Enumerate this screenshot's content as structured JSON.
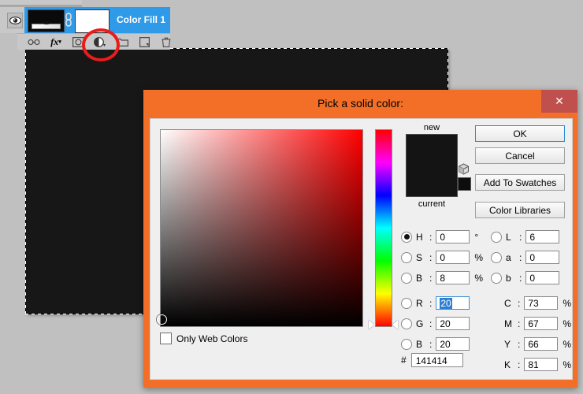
{
  "app": {
    "background_color": "#c0c0c0",
    "canvas_color": "#171717"
  },
  "layers_panel": {
    "layer": {
      "name": "Color Fill 1",
      "selected_color": "#2f9ae8",
      "visibility_icon": "eye-icon",
      "link_icon": "link-icon",
      "thumbnail_color": "#0a0a0a",
      "mask_color": "#ffffff"
    },
    "toolbar_icons": [
      {
        "name": "link-layers-icon",
        "glyph": "link"
      },
      {
        "name": "layer-style-fx-icon",
        "glyph": "fx"
      },
      {
        "name": "add-layer-mask-icon",
        "glyph": "mask"
      },
      {
        "name": "new-adjustment-layer-icon",
        "glyph": "adjustment"
      },
      {
        "name": "new-group-icon",
        "glyph": "folder"
      },
      {
        "name": "new-layer-icon",
        "glyph": "newlayer"
      },
      {
        "name": "delete-layer-icon",
        "glyph": "trash"
      }
    ],
    "highlight_ring_color": "#e81c1c"
  },
  "dialog": {
    "title": "Pick a solid color:",
    "titlebar_color": "#f36f28",
    "close_label": "✕",
    "close_color": "#c0504d",
    "buttons": {
      "ok": "OK",
      "cancel": "Cancel",
      "add_to_swatches": "Add To Swatches",
      "color_libraries": "Color Libraries"
    },
    "preview": {
      "new_label": "new",
      "current_label": "current",
      "new_color": "#141414",
      "current_color": "#141414",
      "gamut_icon": "gamut-cube-icon",
      "gamut_swatch_color": "#0d0d0d"
    },
    "web_colors": {
      "label": "Only Web Colors",
      "checked": false
    },
    "hsb": [
      {
        "key": "H",
        "value": "0",
        "unit": "°",
        "selected": true
      },
      {
        "key": "S",
        "value": "0",
        "unit": "%",
        "selected": false
      },
      {
        "key": "B",
        "value": "8",
        "unit": "%",
        "selected": false
      }
    ],
    "rgb": [
      {
        "key": "R",
        "value": "20",
        "unit": "",
        "selected": false,
        "focused": true
      },
      {
        "key": "G",
        "value": "20",
        "unit": "",
        "selected": false,
        "focused": false
      },
      {
        "key": "B",
        "value": "20",
        "unit": "",
        "selected": false,
        "focused": false
      }
    ],
    "lab": [
      {
        "key": "L",
        "value": "6",
        "unit": ""
      },
      {
        "key": "a",
        "value": "0",
        "unit": ""
      },
      {
        "key": "b",
        "value": "0",
        "unit": ""
      }
    ],
    "cmyk": [
      {
        "key": "C",
        "value": "73",
        "unit": "%"
      },
      {
        "key": "M",
        "value": "67",
        "unit": "%"
      },
      {
        "key": "Y",
        "value": "66",
        "unit": "%"
      },
      {
        "key": "K",
        "value": "81",
        "unit": "%"
      }
    ],
    "hex": {
      "prefix": "#",
      "value": "141414"
    },
    "field": {
      "hue_degrees": 0,
      "marker_x_percent": 0,
      "marker_y_percent": 94
    }
  }
}
